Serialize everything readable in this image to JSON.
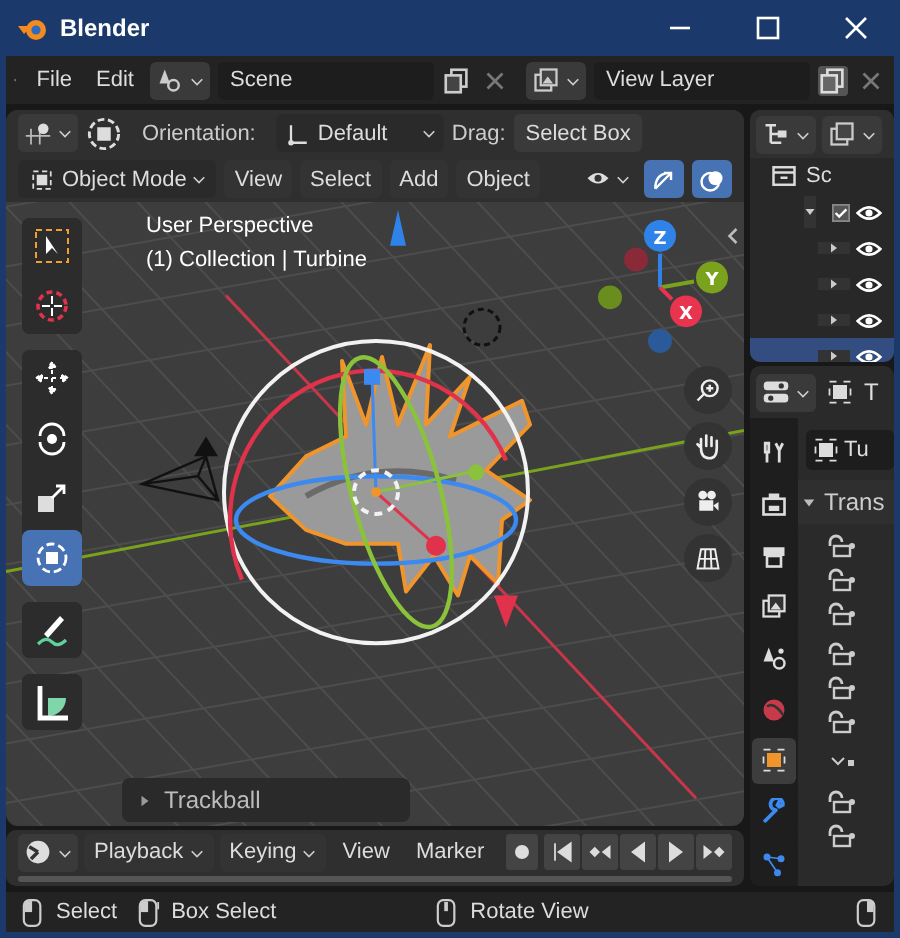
{
  "window": {
    "title": "Blender"
  },
  "topbar": {
    "menus": [
      "File",
      "Edit"
    ],
    "scene": "Scene",
    "view_layer": "View Layer"
  },
  "viewport": {
    "header": {
      "orientation_label": "Orientation:",
      "orientation": "Default",
      "drag_label": "Drag:",
      "drag": "Select Box",
      "mode": "Object Mode",
      "menus": [
        "View",
        "Select",
        "Add",
        "Object"
      ],
      "toggles": [
        {
          "kind": "visibility",
          "on": false
        },
        {
          "kind": "gizmo",
          "on": true
        },
        {
          "kind": "overlay",
          "on": true
        }
      ]
    },
    "overlay_text": [
      "User Perspective",
      "(1) Collection | Turbine"
    ],
    "tool_groups": [
      [
        {
          "kind": "select_box",
          "selected": false
        },
        {
          "kind": "cursor",
          "selected": false
        }
      ],
      [
        {
          "kind": "move",
          "selected": false
        },
        {
          "kind": "rotate",
          "selected": false
        },
        {
          "kind": "scale",
          "selected": false
        },
        {
          "kind": "transform",
          "selected": true
        }
      ],
      [
        {
          "kind": "annotate",
          "selected": false
        }
      ],
      [
        {
          "kind": "measure",
          "selected": false
        }
      ]
    ],
    "axes": [
      {
        "label": "Z",
        "color": "#2f83e8"
      },
      {
        "label": "Y",
        "color": "#7aa21c"
      },
      {
        "label": "X",
        "color": "#e8344f"
      }
    ],
    "last_operator": {
      "title": "Trackball",
      "expanded": false
    }
  },
  "timeline": {
    "menus": [
      {
        "label": "Playback",
        "dropdown": true
      },
      {
        "label": "Keying",
        "dropdown": true
      },
      {
        "label": "View",
        "dropdown": false
      },
      {
        "label": "Marker",
        "dropdown": false
      }
    ]
  },
  "outliner": {
    "scene_label": "Sc",
    "rows": [
      {
        "expanded": true,
        "selected": false
      },
      {
        "expanded": false,
        "selected": false
      },
      {
        "expanded": false,
        "selected": false
      },
      {
        "expanded": false,
        "selected": false
      },
      {
        "expanded": false,
        "selected": true
      }
    ]
  },
  "properties": {
    "header_label": "T",
    "tabs": [
      {
        "kind": "tool",
        "selected": false
      },
      {
        "kind": "render",
        "selected": false
      },
      {
        "kind": "output",
        "selected": false
      },
      {
        "kind": "view_layer",
        "selected": false
      },
      {
        "kind": "scene",
        "selected": false
      },
      {
        "kind": "world",
        "selected": false
      },
      {
        "kind": "object",
        "selected": true
      },
      {
        "kind": "modifier",
        "selected": false
      },
      {
        "kind": "particles",
        "selected": false
      }
    ],
    "object_name": "Tu",
    "panel": {
      "title": "Trans",
      "expanded": true
    }
  },
  "status_bar": [
    {
      "kind": "left_click",
      "label": "Select"
    },
    {
      "kind": "left_drag",
      "label": "Box Select"
    },
    {
      "kind": "middle_click",
      "label": "Rotate View"
    }
  ]
}
